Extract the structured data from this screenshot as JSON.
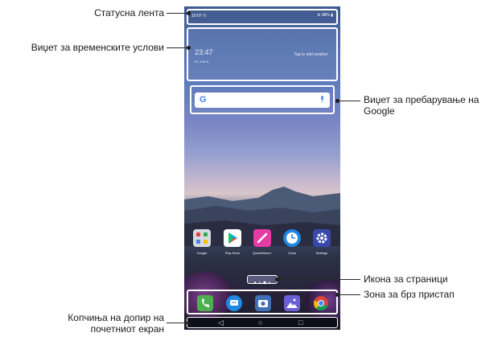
{
  "callouts": {
    "status_bar": "Статусна лента",
    "weather_widget": "Виџет за временските услови",
    "google_search_widget_line1": "Виџет за пребарување на",
    "google_search_widget_line2": "Google",
    "page_icon": "Икона за страници",
    "quick_access": "Зона за брз пристап",
    "home_touch_buttons_line1": "Копчиња на допир на",
    "home_touch_buttons_line2": "почетниот екран"
  },
  "phone": {
    "status_bar": {
      "time": "10:07 ⓑ",
      "right": "⇅ 98% ▮"
    },
    "weather": {
      "time": "23:47",
      "date": "Fri, Feb 8",
      "tap_text": "Tap to add weather"
    },
    "apps": [
      {
        "name": "Google",
        "icon": "folder-icon"
      },
      {
        "name": "Play Store",
        "icon": "play-store-icon"
      },
      {
        "name": "QuickMemo+",
        "icon": "pencil-icon"
      },
      {
        "name": "Clock",
        "icon": "clock-icon"
      },
      {
        "name": "Settings",
        "icon": "gear-icon"
      }
    ],
    "quick_access": [
      "phone-icon",
      "messages-icon",
      "camera-icon",
      "gallery-icon",
      "chrome-icon"
    ],
    "nav": {
      "back": "◁",
      "home": "○",
      "recents": "□"
    }
  },
  "colors": {
    "highlight": "#ffffff",
    "callout_line": "#2a2a2a"
  }
}
